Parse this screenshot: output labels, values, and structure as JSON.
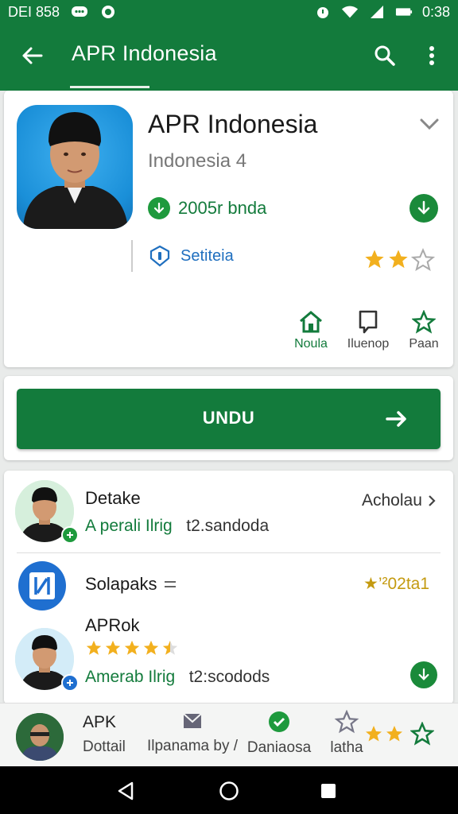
{
  "status_bar": {
    "time_left": "DEI 858",
    "time_right": "0:38"
  },
  "app_bar": {
    "title": "APR Indonesia"
  },
  "app_card": {
    "name": "APR Indonesia",
    "subtitle": "Indonesia 4",
    "downloads_text": "2005r bnda",
    "security_text": "Setiteia",
    "rating_stars": 2,
    "rating_max": 3,
    "actions": [
      {
        "label": "Noula",
        "icon": "home-icon"
      },
      {
        "label": "Iluenop",
        "icon": "bookmark-icon"
      },
      {
        "label": "Paan",
        "icon": "star-outline-icon"
      }
    ]
  },
  "cta": {
    "label": "UNDU"
  },
  "list": {
    "row1": {
      "title": "Detake",
      "sub_green": "A perali Ilrig",
      "sub_plain": "t2.sandoda",
      "right": "Acholau"
    },
    "row2": {
      "title": "Solapaks",
      "right": "★’²02ta1"
    },
    "row3": {
      "title": "APRok",
      "rating_stars": 4.5,
      "sub_green": "Amerab Ilrig",
      "sub_plain": "t2:scodods"
    }
  },
  "bottom_bar": {
    "title": "APK",
    "sub": "Dottail",
    "item1": "Ilpanama by /",
    "item2": "Daniaosa",
    "item3": "latha"
  },
  "colors": {
    "primary": "#137b3c",
    "star": "#f2b01e",
    "link": "#1f6fbf"
  }
}
